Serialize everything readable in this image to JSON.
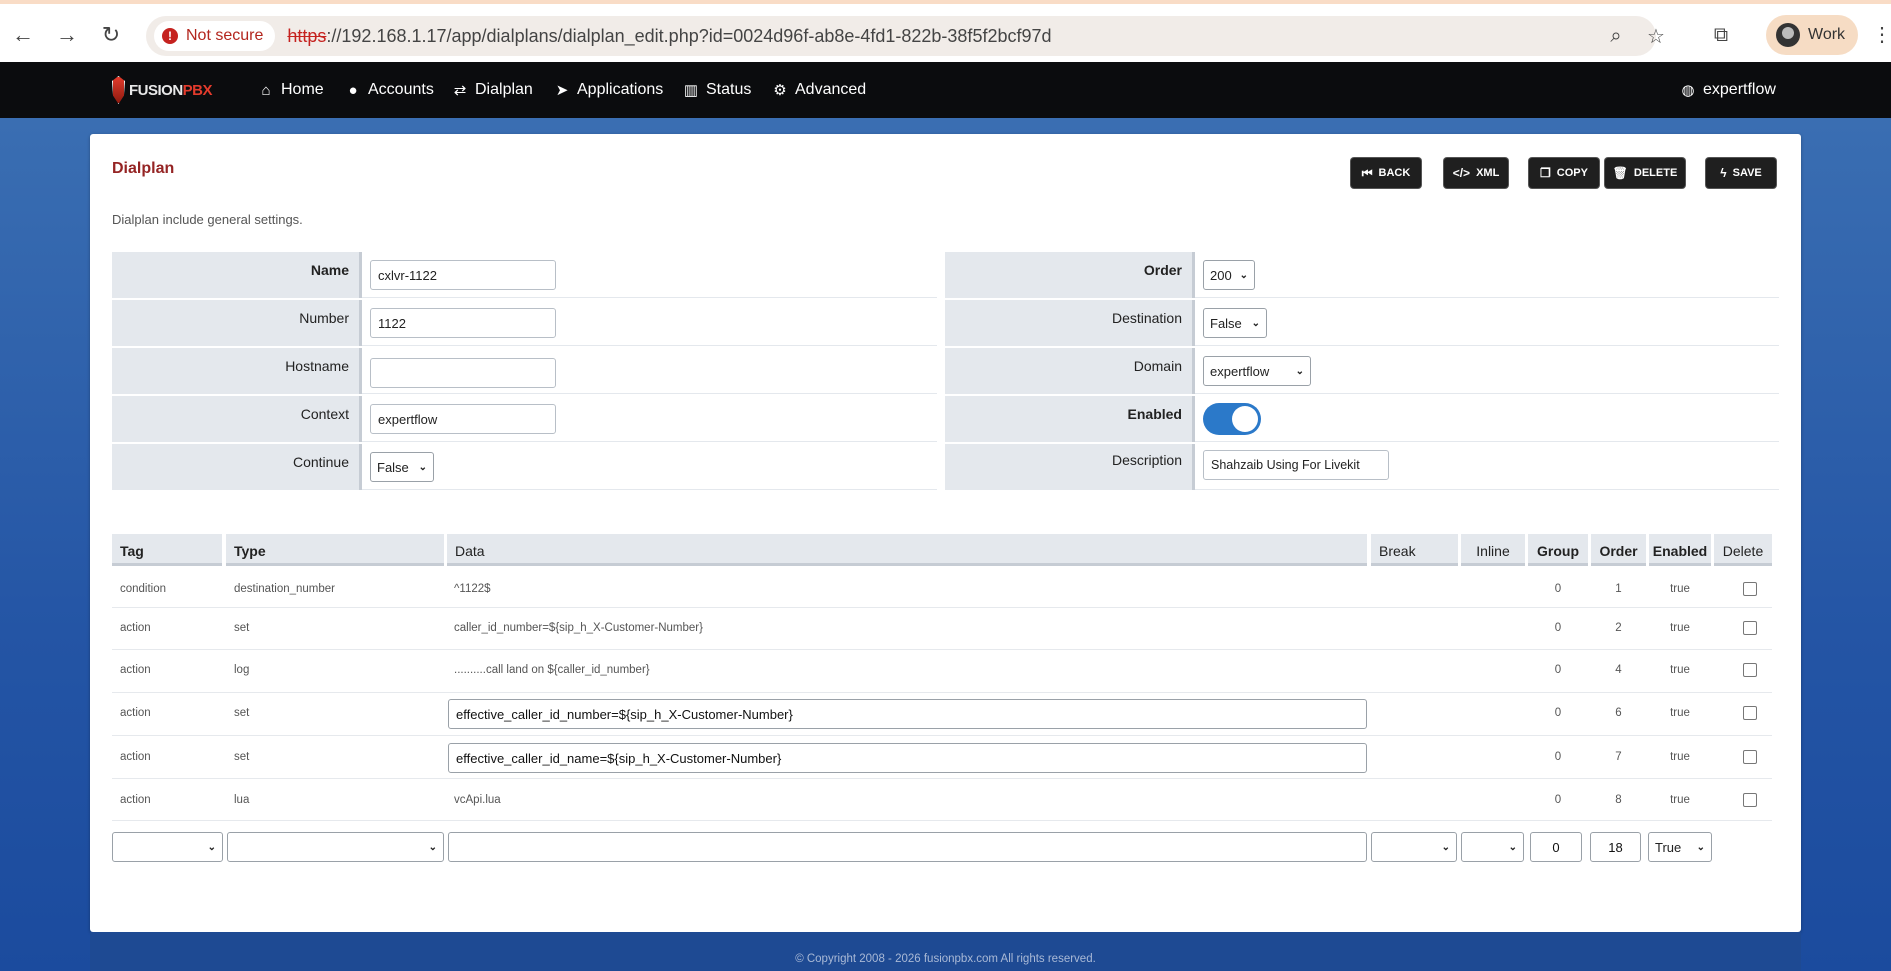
{
  "browser": {
    "security_label": "Not secure",
    "url_scheme": "https",
    "url_rest": "://192.168.1.17/app/dialplans/dialplan_edit.php?id=0024d96f-ab8e-4fd1-822b-38f5f2bcf97d",
    "profile_label": "Work"
  },
  "nav": {
    "logo_part1": "FUSION",
    "logo_part2": "PBX",
    "items": [
      "Home",
      "Accounts",
      "Dialplan",
      "Applications",
      "Status",
      "Advanced"
    ],
    "user": "expertflow"
  },
  "page": {
    "title": "Dialplan",
    "subtitle": "Dialplan include general settings.",
    "buttons": {
      "back": "BACK",
      "xml": "XML",
      "copy": "COPY",
      "delete": "DELETE",
      "save": "SAVE"
    }
  },
  "form": {
    "left": [
      {
        "label": "Name",
        "value": "cxlvr-1122"
      },
      {
        "label": "Number",
        "value": "1122"
      },
      {
        "label": "Hostname",
        "value": ""
      },
      {
        "label": "Context",
        "value": "expertflow"
      },
      {
        "label": "Continue",
        "value": "False"
      }
    ],
    "right": [
      {
        "label": "Order",
        "value": "200"
      },
      {
        "label": "Destination",
        "value": "False"
      },
      {
        "label": "Domain",
        "value": "expertflow"
      },
      {
        "label": "Enabled",
        "value": "on"
      },
      {
        "label": "Description",
        "value": "Shahzaib Using For Livekit"
      }
    ]
  },
  "details": {
    "headers": [
      "Tag",
      "Type",
      "Data",
      "Break",
      "Inline",
      "Group",
      "Order",
      "Enabled",
      "Delete"
    ],
    "rows": [
      {
        "tag": "condition",
        "type": "destination_number",
        "data": "^1122$",
        "group": "0",
        "order": "1",
        "enabled": "true"
      },
      {
        "tag": "action",
        "type": "set",
        "data": "caller_id_number=${sip_h_X-Customer-Number}",
        "group": "0",
        "order": "2",
        "enabled": "true"
      },
      {
        "tag": "action",
        "type": "log",
        "data": "..........call land on ${caller_id_number}",
        "group": "0",
        "order": "4",
        "enabled": "true"
      },
      {
        "tag": "action",
        "type": "set",
        "data": "effective_caller_id_number=${sip_h_X-Customer-Number}",
        "group": "0",
        "order": "6",
        "enabled": "true"
      },
      {
        "tag": "action",
        "type": "set",
        "data": "effective_caller_id_name=${sip_h_X-Customer-Number}",
        "group": "0",
        "order": "7",
        "enabled": "true"
      },
      {
        "tag": "action",
        "type": "lua",
        "data": "vcApi.lua",
        "group": "0",
        "order": "8",
        "enabled": "true"
      }
    ],
    "new_row": {
      "group": "0",
      "order": "18",
      "enabled": "True"
    }
  },
  "footer": "© Copyright 2008 - 2026 fusionpbx.com All rights reserved."
}
